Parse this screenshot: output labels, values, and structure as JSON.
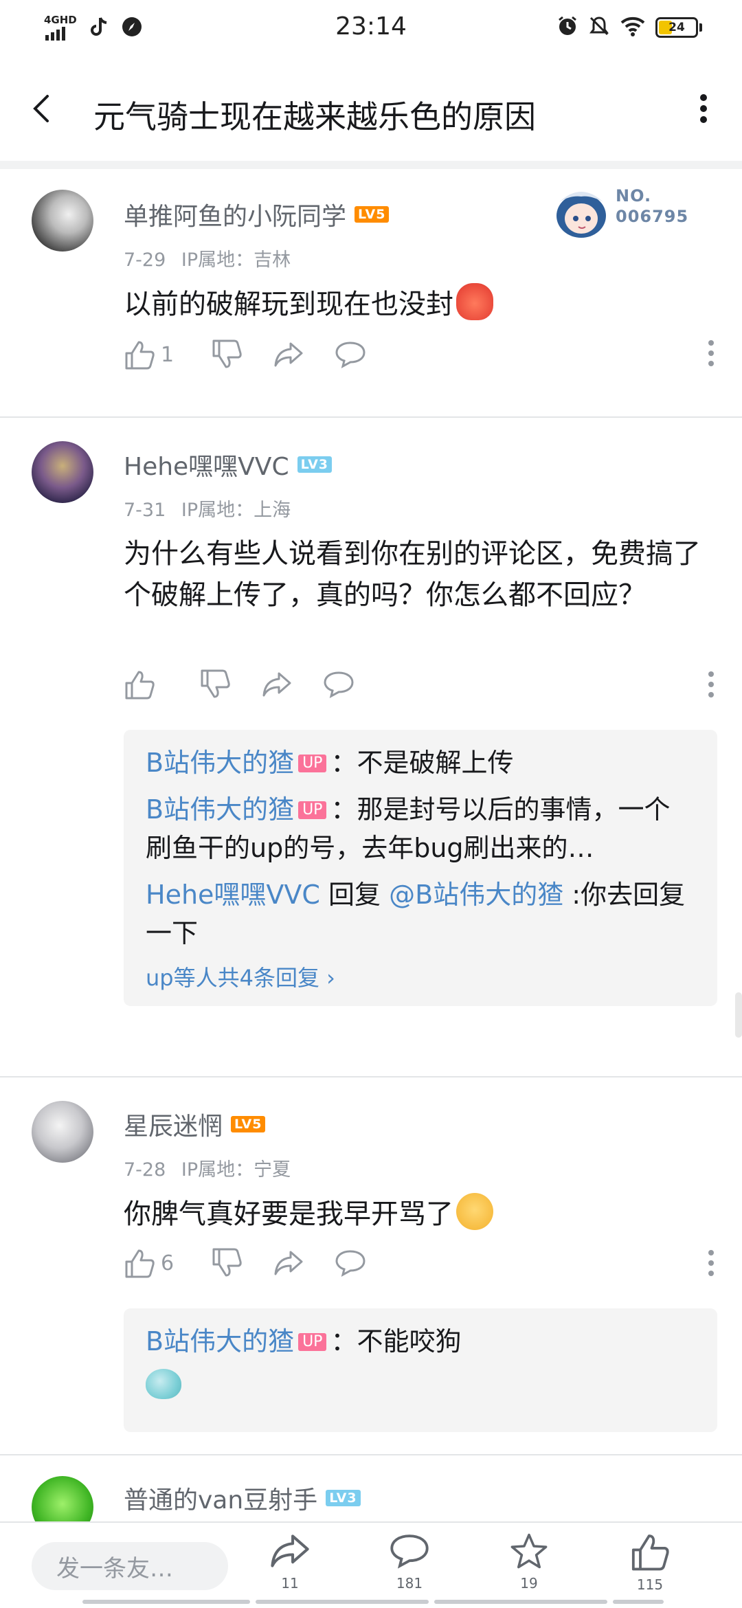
{
  "status_bar": {
    "network": "4GHD",
    "time": "23:14",
    "battery": "24"
  },
  "header": {
    "title": "元气骑士现在越来越乐色的原因"
  },
  "comments": [
    {
      "username": "单推阿鱼的小阮同学",
      "level": "LV5",
      "date": "7-29",
      "ip_location": "IP属地：吉林",
      "badge_text": "NO.\n006795",
      "text": "以前的破解玩到现在也没封",
      "likes": "1"
    },
    {
      "username": "Hehe嘿嘿VVC",
      "level": "LV3",
      "date": "7-31",
      "ip_location": "IP属地：上海",
      "text": "为什么有些人说看到你在别的评论区，免费搞了个破解上传了，真的吗？你怎么都不回应？",
      "likes": "",
      "replies": [
        {
          "name": "B站伟大的猹",
          "badge": "UP",
          "text": "：不是破解上传"
        },
        {
          "name": "B站伟大的猹",
          "badge": "UP",
          "text": "：那是封号以后的事情，一个刷鱼干的up的号，去年bug刷出来的…"
        },
        {
          "name": "Hehe嘿嘿VVC",
          "badge": "",
          "reply_word": " 回复 ",
          "mention": "@B站伟大的猹",
          "text": " :你去回复一下"
        }
      ],
      "more_replies": "up等人共4条回复 ›"
    },
    {
      "username": "星辰迷惘",
      "level": "LV5",
      "date": "7-28",
      "ip_location": "IP属地：宁夏",
      "text": "你脾气真好要是我早开骂了",
      "likes": "6",
      "replies": [
        {
          "name": "B站伟大的猹",
          "badge": "UP",
          "text": "：不能咬狗"
        }
      ]
    },
    {
      "username": "普通的van豆射手",
      "level": "LV3"
    }
  ],
  "bottom_bar": {
    "input_placeholder": "发一条友…",
    "share_count": "11",
    "comment_count": "181",
    "star_count": "19",
    "like_count": "115"
  },
  "colors": {
    "link": "#4a87c7",
    "up_badge": "#fb7299",
    "lv5": "#ff8c00",
    "lv3": "#7bcdef"
  }
}
